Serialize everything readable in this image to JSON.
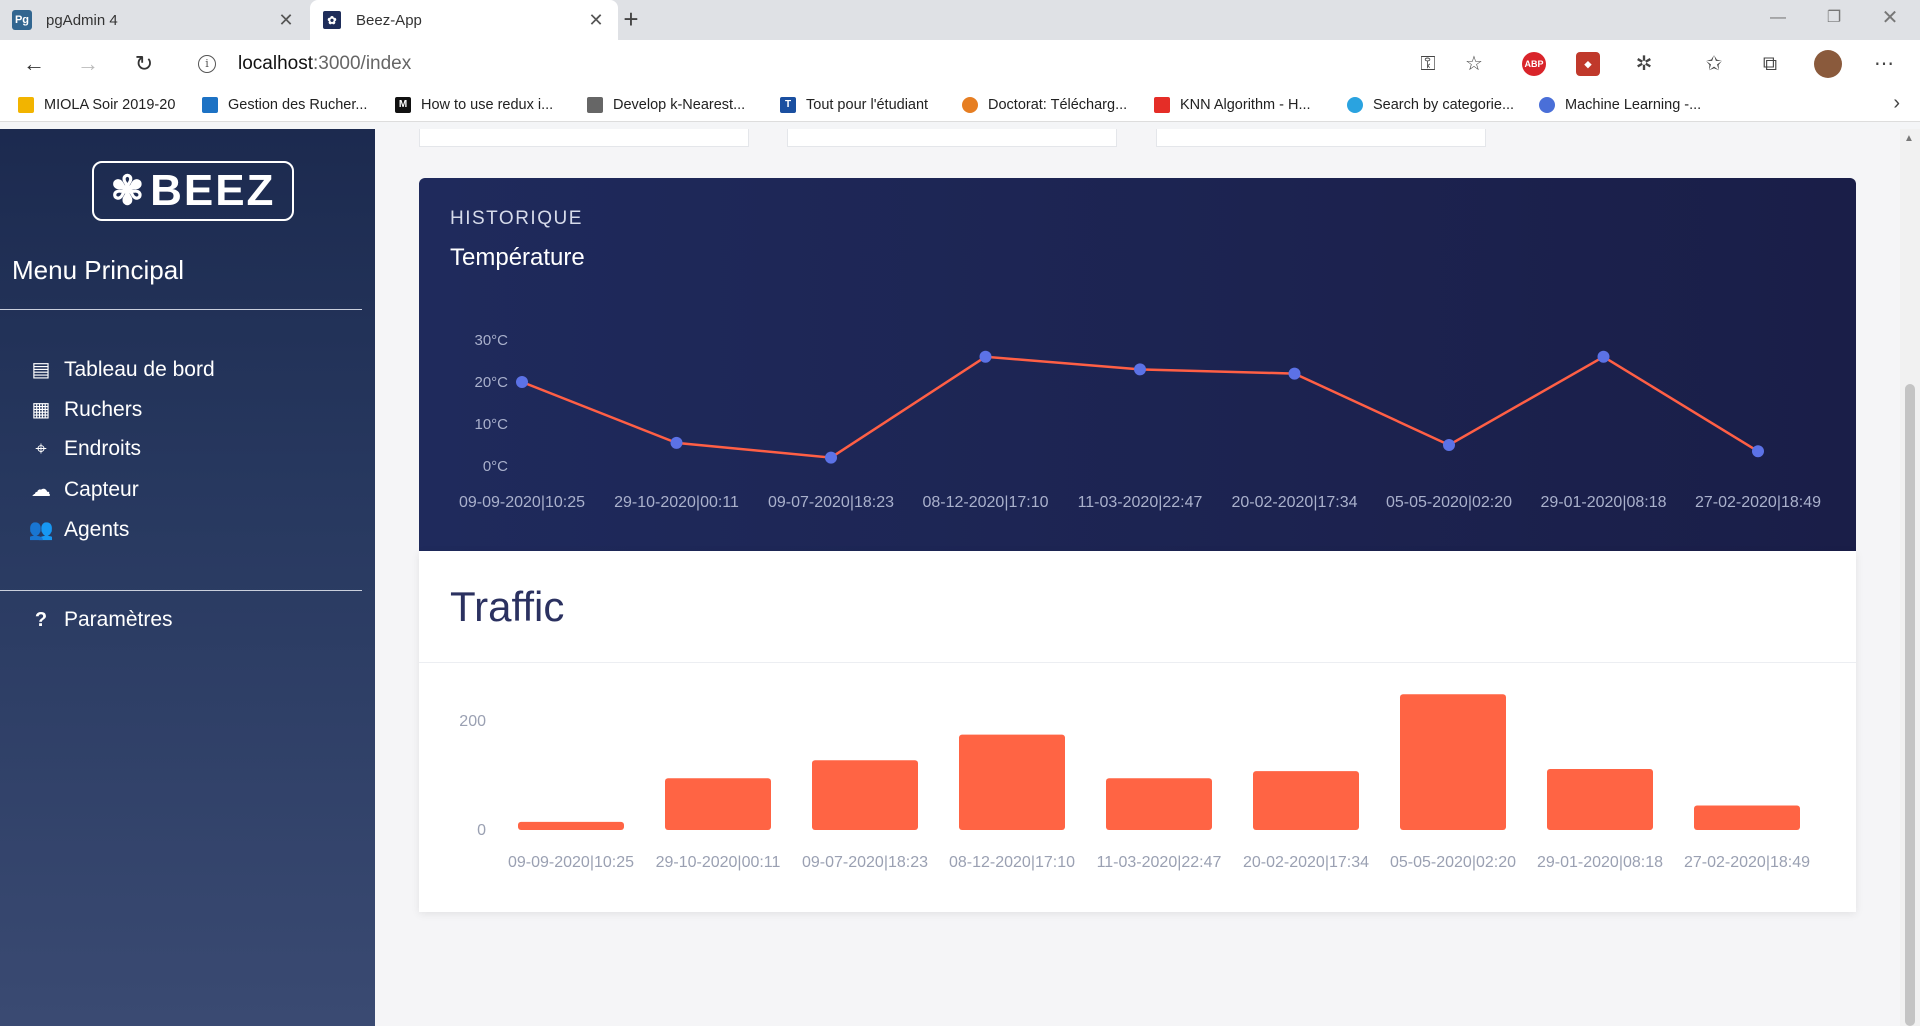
{
  "browser": {
    "tabs": [
      {
        "title": "pgAdmin 4",
        "icon": "pgadmin-icon",
        "favicon_text": "Pg"
      },
      {
        "title": "Beez-App",
        "icon": "beez-icon"
      }
    ],
    "url_host": "localhost",
    "url_path": ":3000/index",
    "bookmarks": [
      "MIOLA Soir 2019-20",
      "Gestion des Rucher...",
      "How to use redux i...",
      "Develop k-Nearest...",
      "Tout pour l'étudiant",
      "Doctorat: Télécharg...",
      "KNN Algorithm - H...",
      "Search by categorie...",
      "Machine Learning -..."
    ],
    "bookmark_favicon_texts": [
      "",
      "",
      "M",
      "",
      "T",
      "",
      "",
      "",
      ""
    ],
    "extension_label": "ABP"
  },
  "sidebar": {
    "logo_text": "BEEZ",
    "menu_title": "Menu Principal",
    "items": [
      {
        "label": "Tableau de bord",
        "icon": "warehouse-icon"
      },
      {
        "label": "Ruchers",
        "icon": "boxes-icon"
      },
      {
        "label": "Endroits",
        "icon": "map-marker-icon"
      },
      {
        "label": "Capteur",
        "icon": "cloud-icon"
      },
      {
        "label": "Agents",
        "icon": "users-icon"
      }
    ],
    "settings": {
      "label": "Paramètres",
      "icon": "question-icon"
    }
  },
  "historique": {
    "subtitle": "HISTORIQUE",
    "title": "Température"
  },
  "traffic": {
    "title": "Traffic"
  },
  "colors": {
    "line": "#ff5f45",
    "point": "#5c72e6",
    "bar": "#ff6444",
    "hist_bg": "#1f2a5c"
  },
  "chart_data": [
    {
      "type": "line",
      "title": "Température",
      "categories": [
        "09-09-2020|10:25",
        "29-10-2020|00:11",
        "09-07-2020|18:23",
        "08-12-2020|17:10",
        "11-03-2020|22:47",
        "20-02-2020|17:34",
        "05-05-2020|02:20",
        "29-01-2020|08:18",
        "27-02-2020|18:49"
      ],
      "values": [
        20,
        5.5,
        2,
        26,
        23,
        22,
        5,
        26,
        3.5
      ],
      "yticks": [
        "0°C",
        "10°C",
        "20°C",
        "30°C"
      ],
      "ylim": [
        0,
        30
      ]
    },
    {
      "type": "bar",
      "title": "Traffic",
      "categories": [
        "09-09-2020|10:25",
        "29-10-2020|00:11",
        "09-07-2020|18:23",
        "08-12-2020|17:10",
        "11-03-2020|22:47",
        "20-02-2020|17:34",
        "05-05-2020|02:20",
        "29-01-2020|08:18",
        "27-02-2020|18:49"
      ],
      "values": [
        15,
        95,
        128,
        175,
        95,
        108,
        249,
        112,
        45
      ],
      "yticks": [
        "0",
        "200"
      ],
      "ylim": [
        0,
        200
      ]
    }
  ]
}
